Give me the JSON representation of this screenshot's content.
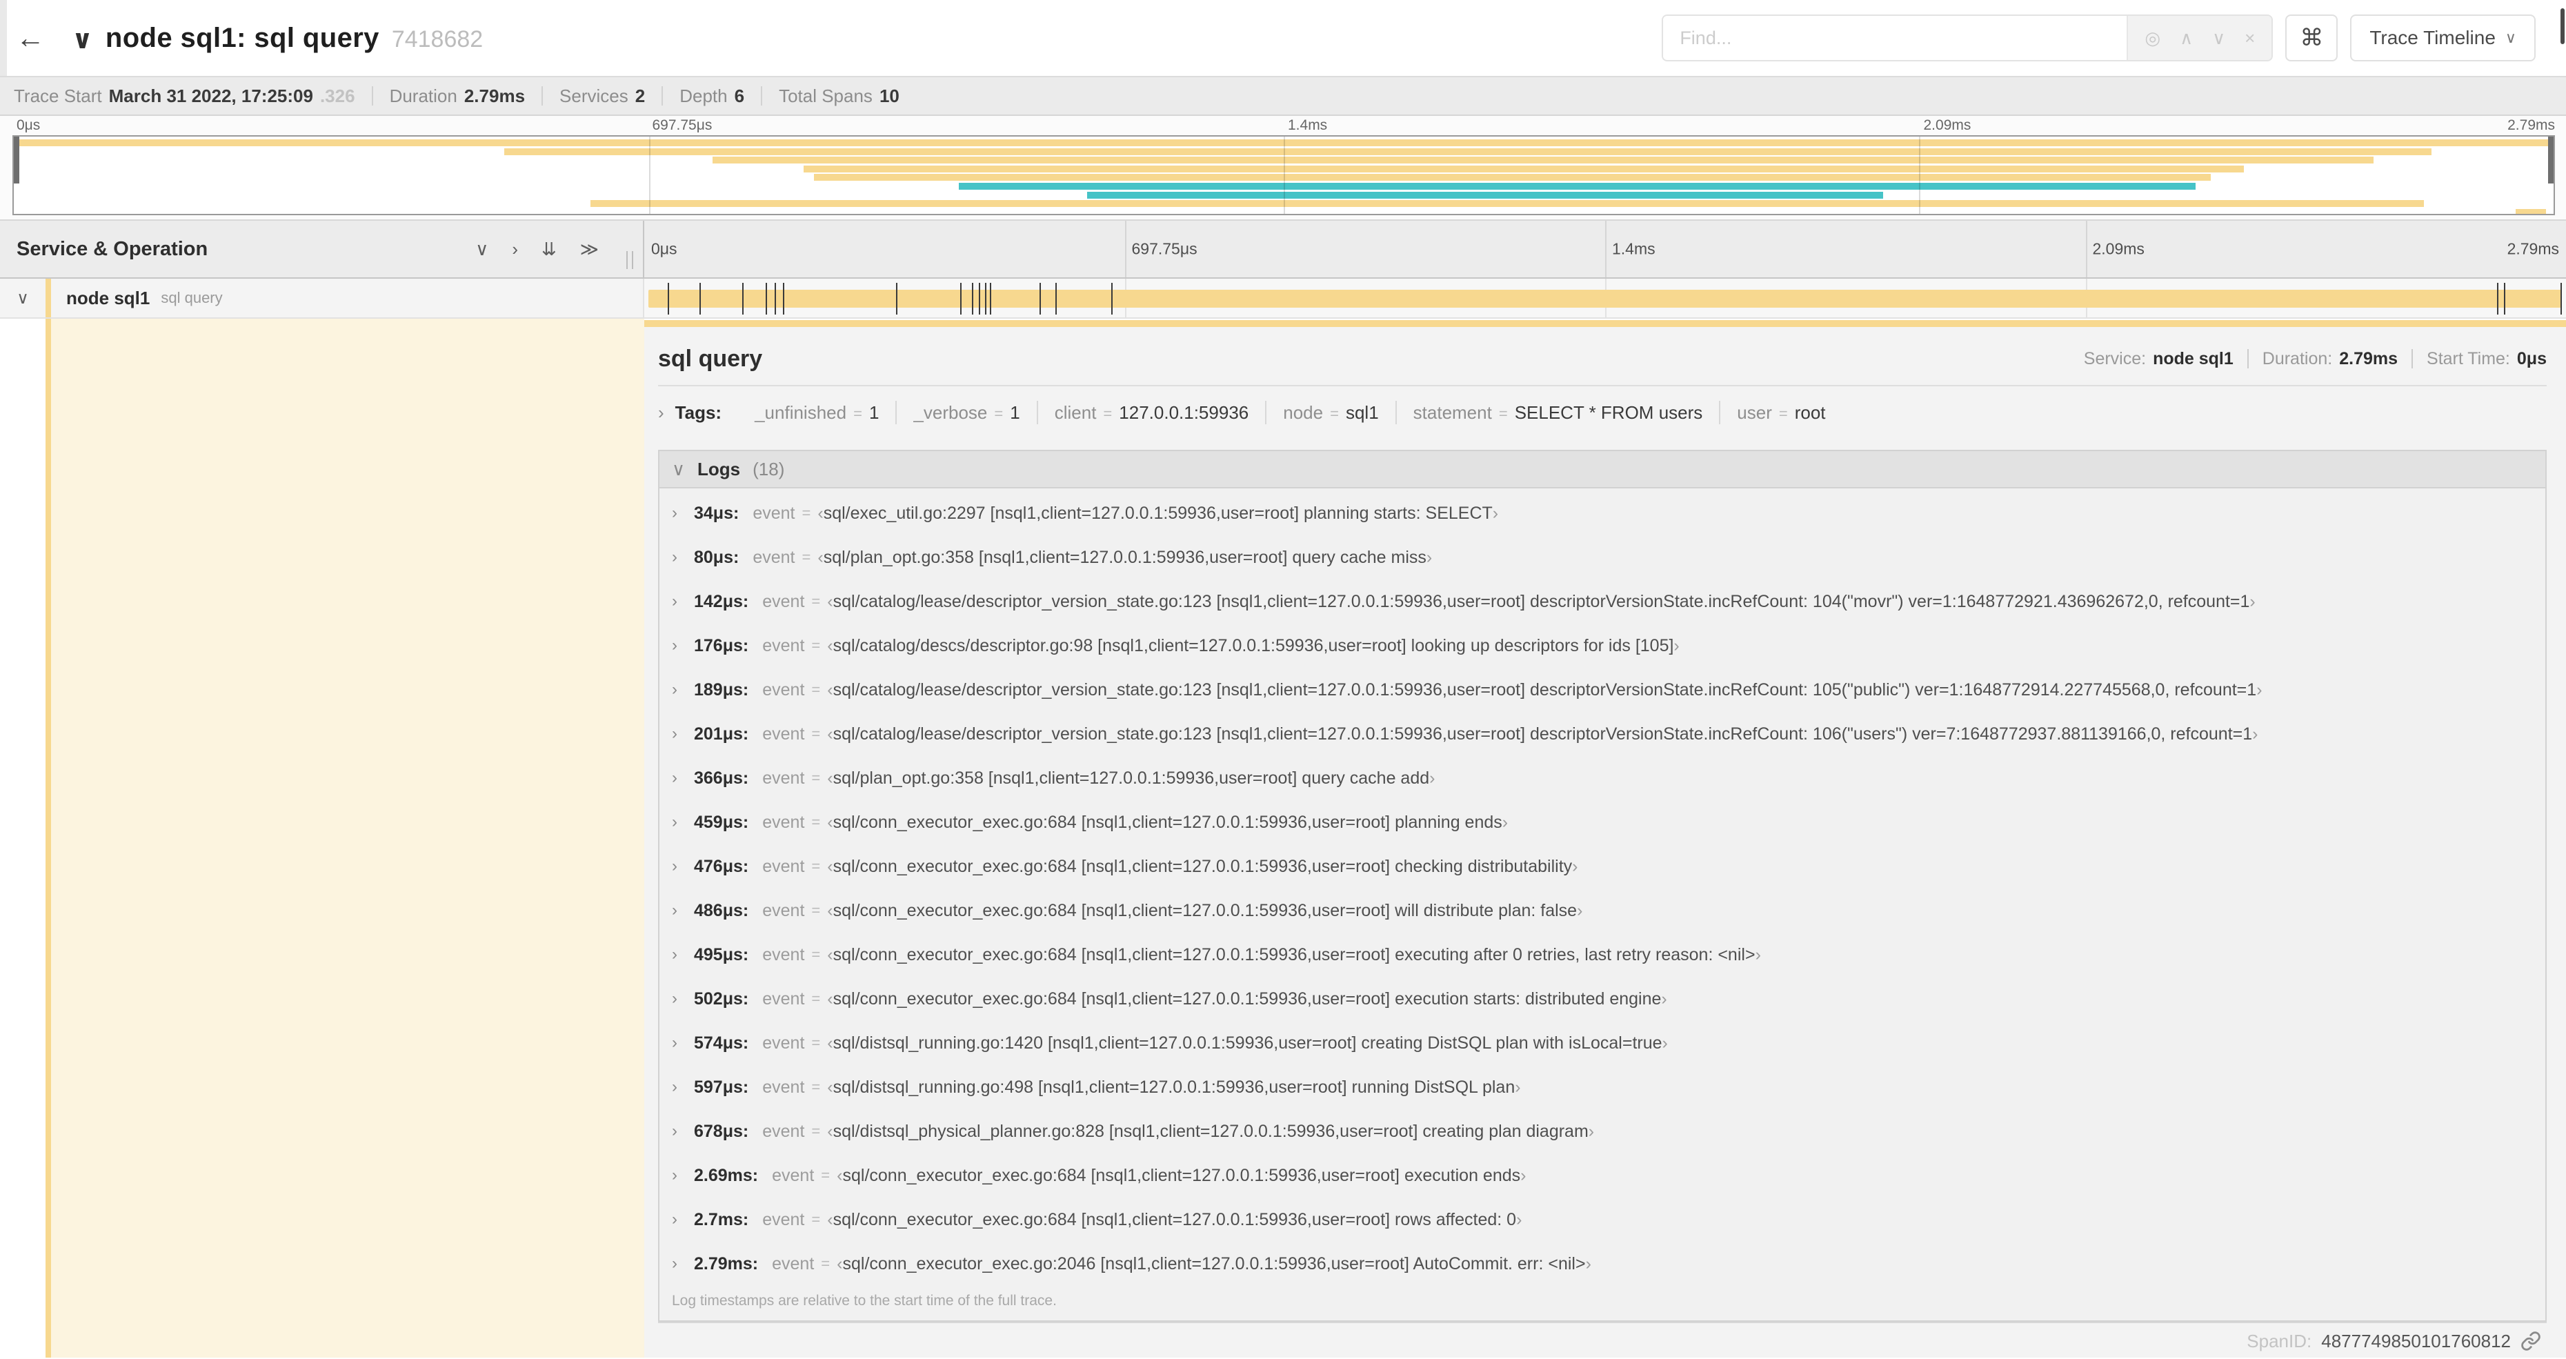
{
  "icons": {
    "back": "←",
    "chevron_down": "∨",
    "chevron_right": "›",
    "collapse_all": "⇊",
    "expand_all": "≫",
    "command": "⌘",
    "target": "◎",
    "caret_up": "∧",
    "caret_down": "∨",
    "close": "×"
  },
  "header": {
    "title": "node sql1: sql query",
    "trace_id": "7418682",
    "find_placeholder": "Find...",
    "view_select": "Trace Timeline"
  },
  "trace_bar": {
    "items": [
      {
        "label": "Trace Start",
        "value": "March 31 2022, 17:25:09",
        "suffix": ".326"
      },
      {
        "label": "Duration",
        "value": "2.79ms"
      },
      {
        "label": "Services",
        "value": "2"
      },
      {
        "label": "Depth",
        "value": "6"
      },
      {
        "label": "Total Spans",
        "value": "10"
      }
    ]
  },
  "ruler": {
    "labels": [
      "0μs",
      "697.75μs",
      "1.4ms",
      "2.09ms",
      "2.79ms"
    ],
    "fractions": [
      0,
      0.25,
      0.5,
      0.75,
      1
    ],
    "gridlines": [
      0.25,
      0.5,
      0.75
    ]
  },
  "duration_us": 2790,
  "colors": {
    "span_tan": "#F7D88F",
    "span_teal": "#46C3C7",
    "select_fill": "#FCF4DF"
  },
  "minimap": {
    "rows": [
      {
        "color": "#F7D88F",
        "start": 0,
        "end": 1
      },
      {
        "color": "#F7D88F",
        "start": 0.193,
        "end": 0.952
      },
      {
        "color": "#F7D88F",
        "start": 0.275,
        "end": 0.929
      },
      {
        "color": "#F7D88F",
        "start": 0.311,
        "end": 0.878
      },
      {
        "color": "#F7D88F",
        "start": 0.315,
        "end": 0.865
      },
      {
        "color": "#46C3C7",
        "start": 0.372,
        "end": 0.859
      },
      {
        "color": "#46C3C7",
        "start": 0.4225,
        "end": 0.736
      },
      {
        "color": "#F7D88F",
        "start": 0.227,
        "end": 0.949
      },
      {
        "color": "#F7D88F",
        "start": 0.985,
        "end": 0.997
      }
    ]
  },
  "grid": {
    "header_label": "Service & Operation"
  },
  "span_row": {
    "service": "node sql1",
    "operation": "sql query"
  },
  "detail": {
    "title": "sql query",
    "meta": [
      {
        "label": "Service:",
        "value": "node sql1"
      },
      {
        "label": "Duration:",
        "value": "2.79ms"
      },
      {
        "label": "Start Time:",
        "value": "0μs"
      }
    ],
    "tags_label": "Tags:",
    "eq": "=",
    "tags": [
      {
        "key": "_unfinished",
        "value": "1"
      },
      {
        "key": "_verbose",
        "value": "1"
      },
      {
        "key": "client",
        "value": "127.0.0.1:59936"
      },
      {
        "key": "node",
        "value": "sql1"
      },
      {
        "key": "statement",
        "value": "SELECT * FROM users"
      },
      {
        "key": "user",
        "value": "root"
      }
    ],
    "logs_label": "Logs",
    "logs_count": "(18)",
    "event_key": "event",
    "quote_open": "‹",
    "quote_close": "›",
    "logs": [
      {
        "t": "34μs:",
        "t_us": 34,
        "msg": "sql/exec_util.go:2297 [nsql1,client=127.0.0.1:59936,user=root] planning starts: SELECT"
      },
      {
        "t": "80μs:",
        "t_us": 80,
        "msg": "sql/plan_opt.go:358 [nsql1,client=127.0.0.1:59936,user=root] query cache miss"
      },
      {
        "t": "142μs:",
        "t_us": 142,
        "msg": "sql/catalog/lease/descriptor_version_state.go:123 [nsql1,client=127.0.0.1:59936,user=root] descriptorVersionState.incRefCount: 104(\"movr\") ver=1:1648772921.436962672,0, refcount=1"
      },
      {
        "t": "176μs:",
        "t_us": 176,
        "msg": "sql/catalog/descs/descriptor.go:98 [nsql1,client=127.0.0.1:59936,user=root] looking up descriptors for ids [105]"
      },
      {
        "t": "189μs:",
        "t_us": 189,
        "msg": "sql/catalog/lease/descriptor_version_state.go:123 [nsql1,client=127.0.0.1:59936,user=root] descriptorVersionState.incRefCount: 105(\"public\") ver=1:1648772914.227745568,0, refcount=1"
      },
      {
        "t": "201μs:",
        "t_us": 201,
        "msg": "sql/catalog/lease/descriptor_version_state.go:123 [nsql1,client=127.0.0.1:59936,user=root] descriptorVersionState.incRefCount: 106(\"users\") ver=7:1648772937.881139166,0, refcount=1"
      },
      {
        "t": "366μs:",
        "t_us": 366,
        "msg": "sql/plan_opt.go:358 [nsql1,client=127.0.0.1:59936,user=root] query cache add"
      },
      {
        "t": "459μs:",
        "t_us": 459,
        "msg": "sql/conn_executor_exec.go:684 [nsql1,client=127.0.0.1:59936,user=root] planning ends"
      },
      {
        "t": "476μs:",
        "t_us": 476,
        "msg": "sql/conn_executor_exec.go:684 [nsql1,client=127.0.0.1:59936,user=root] checking distributability"
      },
      {
        "t": "486μs:",
        "t_us": 486,
        "msg": "sql/conn_executor_exec.go:684 [nsql1,client=127.0.0.1:59936,user=root] will distribute plan: false"
      },
      {
        "t": "495μs:",
        "t_us": 495,
        "msg": "sql/conn_executor_exec.go:684 [nsql1,client=127.0.0.1:59936,user=root] executing after 0 retries, last retry reason: <nil>"
      },
      {
        "t": "502μs:",
        "t_us": 502,
        "msg": "sql/conn_executor_exec.go:684 [nsql1,client=127.0.0.1:59936,user=root] execution starts: distributed engine"
      },
      {
        "t": "574μs:",
        "t_us": 574,
        "msg": "sql/distsql_running.go:1420 [nsql1,client=127.0.0.1:59936,user=root] creating DistSQL plan with isLocal=true"
      },
      {
        "t": "597μs:",
        "t_us": 597,
        "msg": "sql/distsql_running.go:498 [nsql1,client=127.0.0.1:59936,user=root] running DistSQL plan"
      },
      {
        "t": "678μs:",
        "t_us": 678,
        "msg": "sql/distsql_physical_planner.go:828 [nsql1,client=127.0.0.1:59936,user=root] creating plan diagram"
      },
      {
        "t": "2.69ms:",
        "t_us": 2690,
        "msg": "sql/conn_executor_exec.go:684 [nsql1,client=127.0.0.1:59936,user=root] execution ends"
      },
      {
        "t": "2.7ms:",
        "t_us": 2700,
        "msg": "sql/conn_executor_exec.go:684 [nsql1,client=127.0.0.1:59936,user=root] rows affected: 0"
      },
      {
        "t": "2.79ms:",
        "t_us": 2790,
        "msg": "sql/conn_executor_exec.go:2046 [nsql1,client=127.0.0.1:59936,user=root] AutoCommit. err: <nil>"
      }
    ],
    "footnote": "Log timestamps are relative to the start time of the full trace.",
    "span_id_label": "SpanID:",
    "span_id": "4877749850101760812"
  }
}
